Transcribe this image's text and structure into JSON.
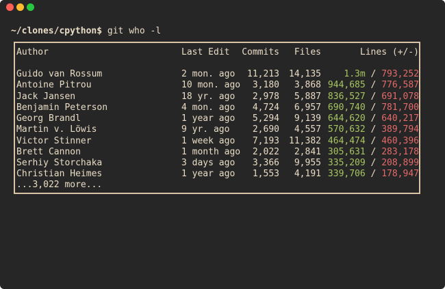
{
  "window": {
    "controls": [
      {
        "name": "close",
        "color": "#ff5f57"
      },
      {
        "name": "minimize",
        "color": "#febc2e"
      },
      {
        "name": "zoom",
        "color": "#28c840"
      }
    ]
  },
  "prompt": {
    "path": "~/clones/cpython$",
    "command": " git who -l"
  },
  "table": {
    "headers": {
      "author": "Author",
      "last_edit": "Last Edit",
      "commits": "Commits",
      "files": "Files",
      "lines": "Lines (+/-)"
    },
    "rows": [
      {
        "author": "Guido van Rossum",
        "last_edit": "2 mon. ago",
        "commits": "11,213",
        "files": "14,135",
        "added": "1.3m",
        "sep": " / ",
        "removed": "793,252"
      },
      {
        "author": "Antoine Pitrou",
        "last_edit": "10 mon. ago",
        "commits": "3,180",
        "files": "3,868",
        "added": "944,685",
        "sep": " / ",
        "removed": "776,587"
      },
      {
        "author": "Jack Jansen",
        "last_edit": "18 yr. ago",
        "commits": "2,978",
        "files": "5,887",
        "added": "836,527",
        "sep": " / ",
        "removed": "691,078"
      },
      {
        "author": "Benjamin Peterson",
        "last_edit": "4 mon. ago",
        "commits": "4,724",
        "files": "6,957",
        "added": "690,740",
        "sep": " / ",
        "removed": "781,700"
      },
      {
        "author": "Georg Brandl",
        "last_edit": "1 year ago",
        "commits": "5,294",
        "files": "9,139",
        "added": "644,620",
        "sep": " / ",
        "removed": "640,217"
      },
      {
        "author": "Martin v. Löwis",
        "last_edit": "9 yr. ago",
        "commits": "2,690",
        "files": "4,557",
        "added": "570,632",
        "sep": " / ",
        "removed": "389,794"
      },
      {
        "author": "Victor Stinner",
        "last_edit": "1 week ago",
        "commits": "7,193",
        "files": "11,382",
        "added": "464,474",
        "sep": " / ",
        "removed": "460,396"
      },
      {
        "author": "Brett Cannon",
        "last_edit": "1 month ago",
        "commits": "2,022",
        "files": "2,841",
        "added": "305,631",
        "sep": " / ",
        "removed": "283,178"
      },
      {
        "author": "Serhiy Storchaka",
        "last_edit": "3 days ago",
        "commits": "3,366",
        "files": "9,955",
        "added": "335,209",
        "sep": " / ",
        "removed": "208,899"
      },
      {
        "author": "Christian Heimes",
        "last_edit": "1 year ago",
        "commits": "1,553",
        "files": "4,191",
        "added": "339,706",
        "sep": " / ",
        "removed": "178,947"
      }
    ],
    "more": "...3,022 more..."
  },
  "colors": {
    "background": "#262626",
    "text": "#e9dcc6",
    "border": "#d9c5a6",
    "added": "#a8c561",
    "removed": "#e56a6a"
  }
}
